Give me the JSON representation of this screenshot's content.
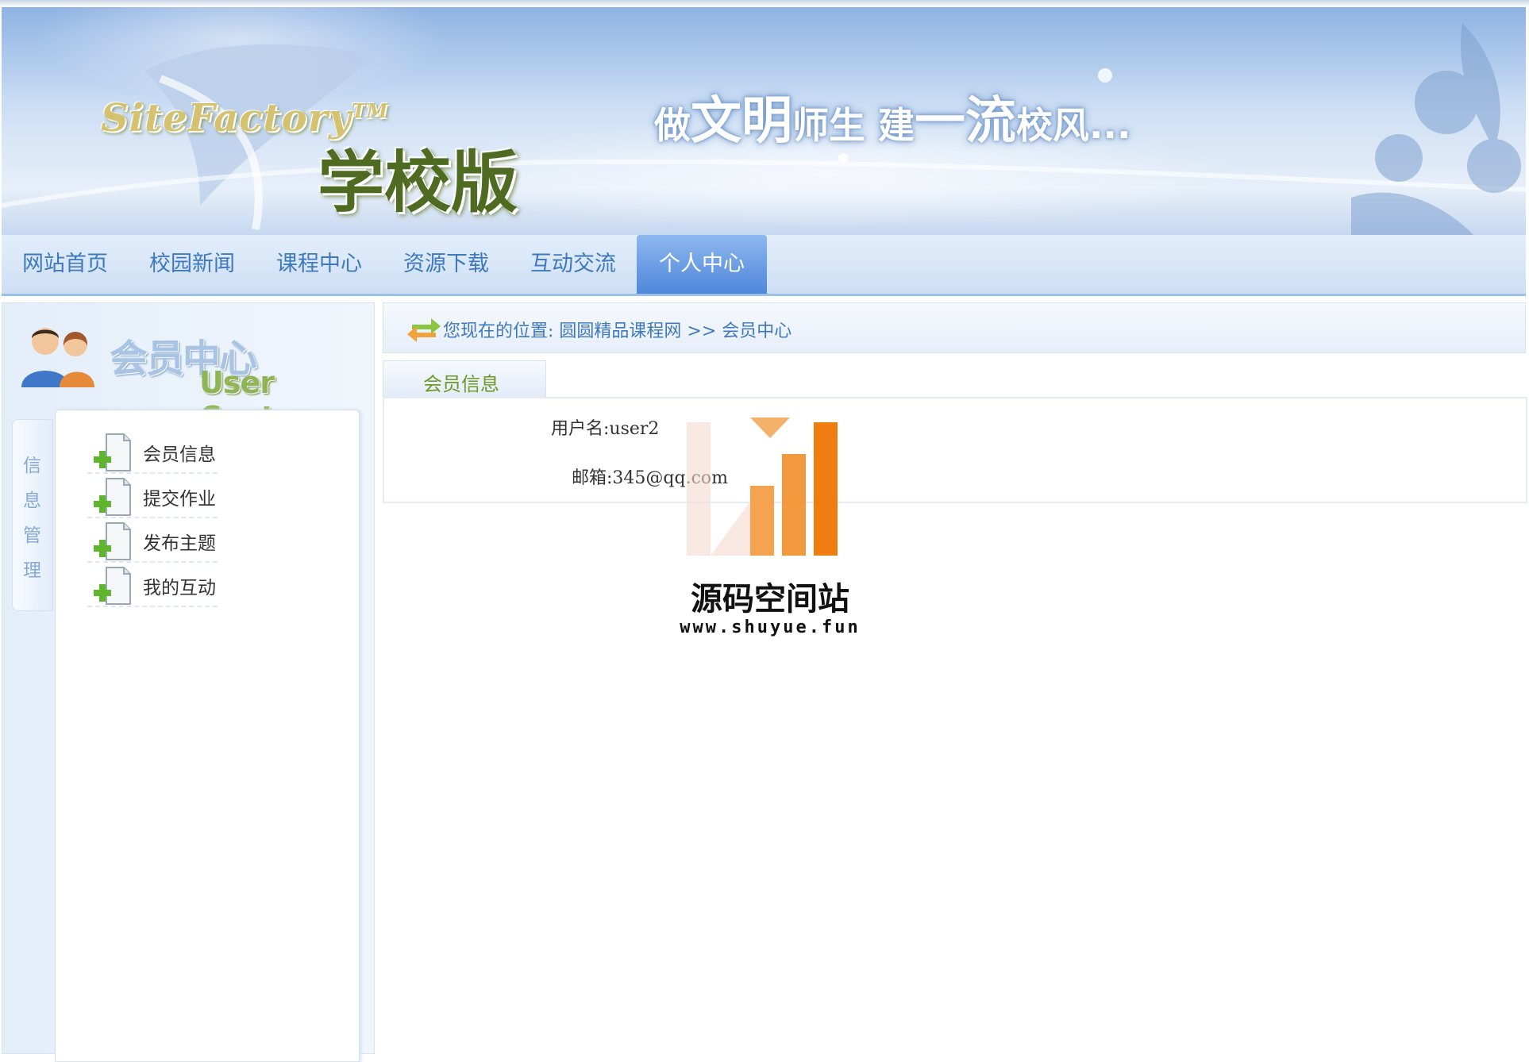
{
  "banner": {
    "logo_en": "SiteFactory",
    "logo_tm": "TM",
    "logo_cn": "学校版",
    "slogan": [
      {
        "text": "做",
        "size": "small"
      },
      {
        "text": "文明",
        "size": "big"
      },
      {
        "text": "师生",
        "size": "small"
      },
      {
        "text": " 建",
        "size": "small"
      },
      {
        "text": "一流",
        "size": "big"
      },
      {
        "text": "校风...",
        "size": "small"
      }
    ]
  },
  "nav": {
    "items": [
      "网站首页",
      "校园新闻",
      "课程中心",
      "资源下载",
      "互动交流",
      "个人中心"
    ],
    "active": "个人中心"
  },
  "sidebar": {
    "title_cn": "会员中心",
    "title_en": "User Center",
    "vertical_tab": [
      "信",
      "息",
      "管",
      "理"
    ],
    "menu": [
      "会员信息",
      "提交作业",
      "发布主题",
      "我的互动"
    ]
  },
  "breadcrumb": {
    "text": "您现在的位置:  圆圆精品课程网 >> 会员中心"
  },
  "tab": {
    "label": "会员信息"
  },
  "member": {
    "username_line": "用户名:user2",
    "email_line": "邮箱:345@qq.com"
  },
  "watermark": {
    "title": "源码空间站",
    "url": "www.shuyue.fun"
  },
  "colors": {
    "nav_text": "#3f79bd",
    "nav_active_bg": "#4f87da",
    "tab_text": "#6e9a2a",
    "watermark_orange": "#f07d12"
  }
}
